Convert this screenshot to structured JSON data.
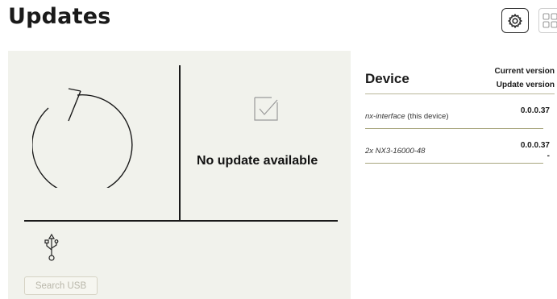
{
  "page": {
    "title": "Updates"
  },
  "toolbar": {
    "settings_icon": "gear-icon",
    "layout_icon": "grid-icon"
  },
  "left_panel": {
    "status_text": "No update available",
    "refresh_icon": "refresh-icon",
    "check_icon": "checkbox-check-icon",
    "usb_icon": "usb-icon",
    "search_usb_label": "Search USB"
  },
  "devices_table": {
    "headers": {
      "device": "Device",
      "current_version": "Current version",
      "update_version": "Update version"
    },
    "rows": [
      {
        "name": "nx-interface",
        "suffix": " (this device)",
        "current_version": "0.0.0.37",
        "update_version": ""
      },
      {
        "name": "2x NX3-16000-48",
        "suffix": "",
        "current_version": "0.0.0.37",
        "update_version": "-"
      }
    ]
  },
  "colors": {
    "panel_background": "#f1f2ec",
    "divider_line": "#1a1a1a",
    "row_underline": "#a8a67e",
    "disabled_button_text": "#b9b7aa"
  }
}
